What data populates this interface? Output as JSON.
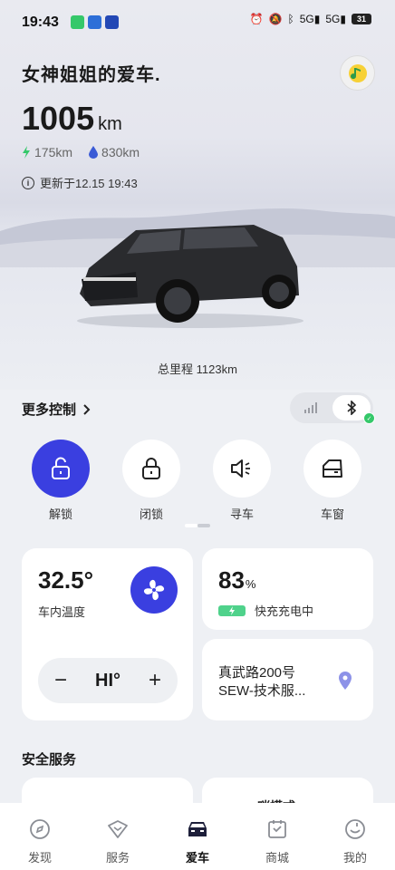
{
  "status_bar": {
    "time": "19:43",
    "network_1": "5G",
    "network_2": "5G",
    "battery": "31"
  },
  "header": {
    "car_title": "女神姐姐的爱车.",
    "range_value": "1005",
    "range_unit": "km",
    "electric_range": "175km",
    "fuel_range": "830km",
    "updated_text": "更新于12.15 19:43",
    "odometer": "总里程 1123km"
  },
  "controls": {
    "more_label": "更多控制",
    "items": [
      {
        "label": "解锁",
        "icon": "unlock-icon"
      },
      {
        "label": "闭锁",
        "icon": "lock-icon"
      },
      {
        "label": "寻车",
        "icon": "horn-icon"
      },
      {
        "label": "车窗",
        "icon": "window-icon"
      }
    ]
  },
  "climate": {
    "temperature": "32.5°",
    "label": "车内温度",
    "level": "HI°",
    "minus": "−",
    "plus": "+"
  },
  "battery_card": {
    "percent": "83",
    "unit": "%",
    "status": "快充充电中",
    "charge_level": 0.83
  },
  "location": {
    "address": "真武路200号 SEW-技术服..."
  },
  "safety": {
    "title": "安全服务",
    "peek_label": "哨模式"
  },
  "tabs": [
    {
      "label": "发现",
      "icon": "compass-icon"
    },
    {
      "label": "服务",
      "icon": "service-icon"
    },
    {
      "label": "爱车",
      "icon": "car-icon"
    },
    {
      "label": "商城",
      "icon": "shop-icon"
    },
    {
      "label": "我的",
      "icon": "profile-icon"
    }
  ],
  "colors": {
    "accent": "#3a3fe0",
    "charge_green": "#4fd28b",
    "electric_green": "#35c86a",
    "fuel_blue": "#3b5bd6"
  }
}
